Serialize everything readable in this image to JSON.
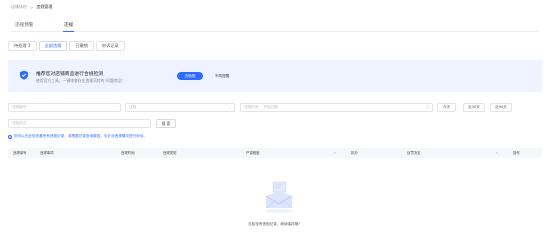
{
  "breadcrumb": {
    "parent": "店铺体检",
    "current": "违规管理"
  },
  "main_tabs": [
    {
      "label": "违规预警",
      "active": false
    },
    {
      "label": "违规",
      "active": true
    }
  ],
  "sub_tabs": [
    {
      "label": "待处理 3",
      "active": false
    },
    {
      "label": "全部违规",
      "active": true
    },
    {
      "label": "已撤销",
      "active": false
    },
    {
      "label": "申诉记录",
      "active": false
    }
  ],
  "banner": {
    "title": "推荐您对店铺商品进行合规检测",
    "description": "使用官方工具，一键排查存在违规风险的“问题商品”",
    "primary_label": "去检测",
    "secondary_label": "不再提醒",
    "accent_color": "#2f6bff"
  },
  "filters": {
    "violation_no_placeholder": "违规编号",
    "type_placeholder": "违规",
    "date_start_placeholder": "违规时间",
    "date_end_placeholder": "开始日期",
    "date_icon": "calendar-icon",
    "status_placeholder": "违规状态",
    "quick_ranges": [
      "今天",
      "近30天",
      "近90天"
    ],
    "search_label": "搜 索"
  },
  "notice": "您可以在此处查看所有违规记录，或根据记录查询原因，可针对违规情况进行申诉。",
  "table": {
    "columns": [
      "违规单号",
      "违规事项",
      "违规时间",
      "违规类型",
      "严重程度",
      "扣分",
      "处罚决定",
      "操作"
    ]
  },
  "empty_state": {
    "text": "当前没有违规记录，继续保持哦！"
  }
}
